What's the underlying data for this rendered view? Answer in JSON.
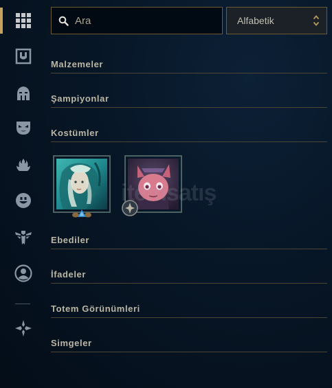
{
  "sidebar": {
    "items": [
      {
        "icon": "grid-icon",
        "active": true
      },
      {
        "icon": "shield-crest-icon"
      },
      {
        "icon": "helmet-icon"
      },
      {
        "icon": "mask-icon"
      },
      {
        "icon": "flame-icon"
      },
      {
        "icon": "smiley-icon"
      },
      {
        "icon": "ward-totem-icon"
      },
      {
        "icon": "profile-icon"
      },
      {
        "icon": "diamond-emblem-icon"
      }
    ],
    "accent_color": "#c8a25d"
  },
  "search": {
    "placeholder": "Ara",
    "value": ""
  },
  "sort": {
    "selected": "Alfabetik"
  },
  "sections": {
    "items_title": "Malzemeler",
    "champions_title": "Şampiyonlar",
    "skins_title": "Kostümler",
    "eternals_title": "Ebediler",
    "emotes_title": "İfadeler",
    "ward_skins_title": "Totem Görünümleri",
    "icons_title": "Simgeler"
  },
  "skins": [
    {
      "name": "skin-tile-1",
      "badge": "blue-triangle-badge-icon"
    },
    {
      "name": "skin-tile-2",
      "badge": "round-emblem-badge-icon"
    }
  ],
  "watermark": {
    "text": "itemsatış"
  },
  "colors": {
    "gold_border": "#6e5a30",
    "section_text": "#bcb7a4",
    "background": "#071626"
  }
}
